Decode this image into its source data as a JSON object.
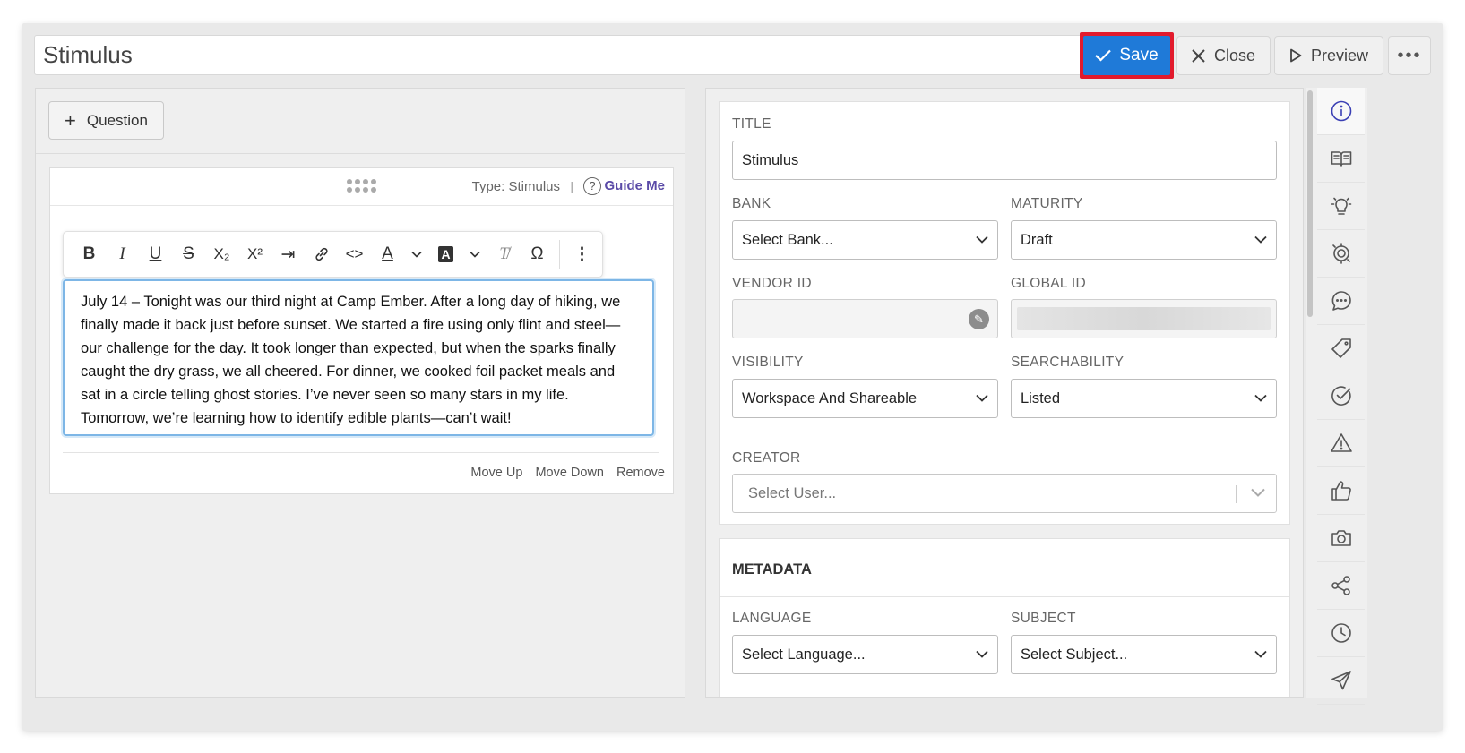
{
  "header": {
    "title_value": "Stimulus",
    "save_label": "Save",
    "close_label": "Close",
    "preview_label": "Preview",
    "more_label": "•••"
  },
  "left": {
    "add_question_label": "Question",
    "card": {
      "type_label": "Type: Stimulus",
      "divider": "|",
      "guide_label": "Guide Me",
      "guide_icon_glyph": "?",
      "content": "July 14 – Tonight was our third night at Camp Ember. After a long day of hiking, we finally made it back just before sunset. We started a fire using only flint and steel—our challenge for the day. It took longer than expected, but when the sparks finally caught the dry grass, we all cheered. For dinner, we cooked foil packet meals and sat in a circle telling ghost stories. I’ve never seen so many stars in my life. Tomorrow, we’re learning how to identify edible plants—can’t wait!",
      "actions": {
        "move_up": "Move Up",
        "move_down": "Move Down",
        "remove": "Remove"
      }
    },
    "toolbar": {
      "bold": "B",
      "italic": "I",
      "underline": "U",
      "strike": "S",
      "subscript": "X₂",
      "superscript": "X²",
      "indent": "⇥",
      "link": "🔗",
      "code": "<>",
      "font_color": "A",
      "highlight": "A",
      "clear": "T̸",
      "omega": "Ω",
      "more": "⋮",
      "dropdown": "⌄"
    }
  },
  "properties": {
    "title_label": "TITLE",
    "title_value": "Stimulus",
    "bank_label": "BANK",
    "bank_value": "Select Bank...",
    "maturity_label": "MATURITY",
    "maturity_value": "Draft",
    "vendor_id_label": "VENDOR ID",
    "vendor_id_value": "",
    "global_id_label": "GLOBAL ID",
    "visibility_label": "VISIBILITY",
    "visibility_value": "Workspace And Shareable",
    "searchability_label": "SEARCHABILITY",
    "searchability_value": "Listed",
    "creator_label": "CREATOR",
    "creator_placeholder": "Select User..."
  },
  "metadata": {
    "title": "METADATA",
    "language_label": "LANGUAGE",
    "language_value": "Select Language...",
    "subject_label": "SUBJECT",
    "subject_value": "Select Subject..."
  },
  "rail": {
    "items": [
      "info-icon",
      "book-icon",
      "lightbulb-icon",
      "target-icon",
      "comment-icon",
      "tag-icon",
      "check-circle-icon",
      "warning-icon",
      "thumbs-up-icon",
      "camera-icon",
      "share-icon",
      "clock-icon",
      "send-icon"
    ],
    "active": "info-icon",
    "active_color": "#3a3fb4"
  },
  "colors": {
    "save": "#1f7ad8",
    "highlight_frame": "#e21a2c",
    "guide": "#5a4aa7"
  }
}
